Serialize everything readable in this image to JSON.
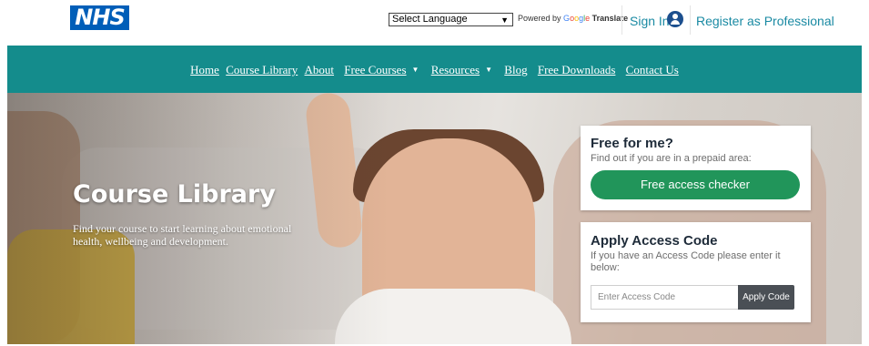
{
  "header": {
    "logo_text": "NHS",
    "language_select": "Select Language",
    "powered_by": "Powered by",
    "google_letters": [
      "G",
      "o",
      "o",
      "g",
      "l",
      "e"
    ],
    "translate": "Translate",
    "sign_in": "Sign In",
    "register": "Register as Professional"
  },
  "nav": {
    "home": "Home",
    "course_library": "Course Library",
    "about": "About",
    "free_courses": "Free Courses",
    "resources": "Resources",
    "blog": "Blog",
    "free_downloads": "Free Downloads",
    "contact_us": "Contact Us"
  },
  "hero": {
    "title": "Course Library",
    "subtitle": "Find your course to start learning about emotional health, wellbeing and development."
  },
  "free_card": {
    "title": "Free for me?",
    "text": "Find out if you are in a prepaid area:",
    "button": "Free access checker"
  },
  "code_card": {
    "title": "Apply Access Code",
    "text": "If you have an Access Code please enter it below:",
    "placeholder": "Enter Access Code",
    "button": "Apply Code"
  },
  "colors": {
    "nav_bg": "#148c8c",
    "nhs_blue": "#005eb8",
    "link": "#1a8aa3",
    "cta_green": "#21955a",
    "apply_btn": "#4a4f55"
  }
}
